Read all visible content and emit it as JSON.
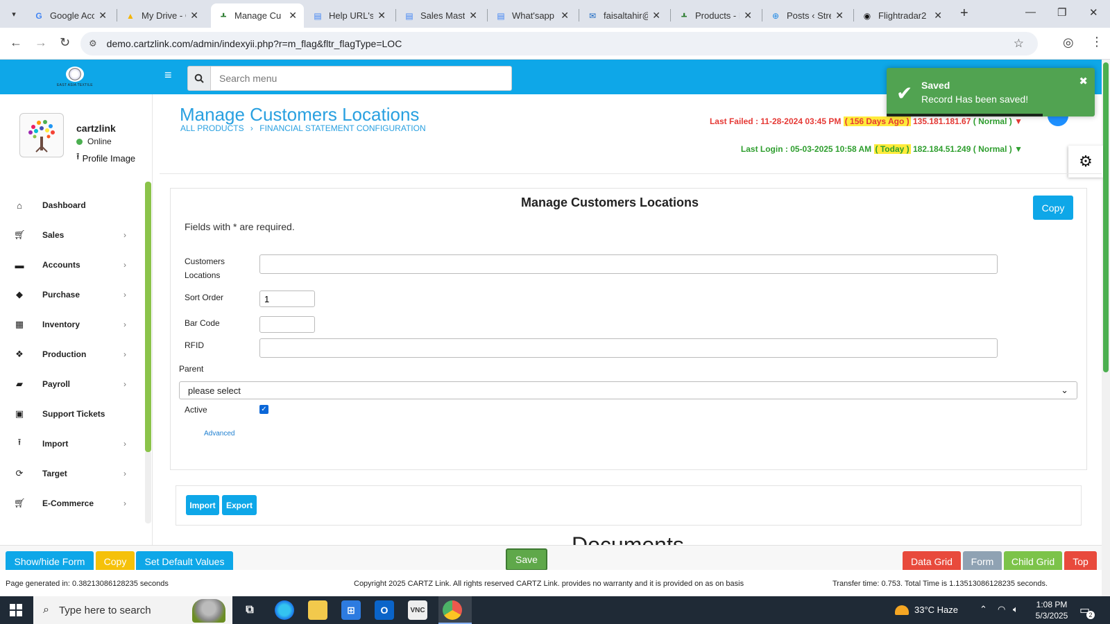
{
  "browser": {
    "tabs": [
      {
        "title": "Google Acc",
        "icon": "google-icon"
      },
      {
        "title": "My Drive - G",
        "icon": "drive-icon"
      },
      {
        "title": "Manage Cu",
        "icon": "cartz-icon",
        "active": true
      },
      {
        "title": "Help URL's",
        "icon": "docs-icon"
      },
      {
        "title": "Sales Maste",
        "icon": "docs-icon"
      },
      {
        "title": "What'sapp",
        "icon": "docs-icon"
      },
      {
        "title": "faisaltahir@",
        "icon": "mail-icon"
      },
      {
        "title": "Products - F",
        "icon": "cartz-icon"
      },
      {
        "title": "Posts ‹ Strea",
        "icon": "wordpress-icon"
      },
      {
        "title": "Flightradar2",
        "icon": "flightradar-icon"
      }
    ],
    "url": "demo.cartzlink.com/admin/indexyii.php?r=m_flag&fltr_flagType=LOC"
  },
  "header": {
    "brand_text": "EAST ASIA TEXTILE",
    "search_placeholder": "Search menu"
  },
  "profile": {
    "name": "cartzlink",
    "status": "Online",
    "image_link": "Profile Image"
  },
  "sidebar": {
    "items": [
      {
        "label": "Dashboard",
        "icon": "home-icon",
        "has_children": false
      },
      {
        "label": "Sales",
        "icon": "cart-icon",
        "has_children": true
      },
      {
        "label": "Accounts",
        "icon": "briefcase-icon",
        "has_children": true
      },
      {
        "label": "Purchase",
        "icon": "tags-icon",
        "has_children": true
      },
      {
        "label": "Inventory",
        "icon": "grid-icon",
        "has_children": true
      },
      {
        "label": "Production",
        "icon": "dropbox-icon",
        "has_children": true
      },
      {
        "label": "Payroll",
        "icon": "money-icon",
        "has_children": true
      },
      {
        "label": "Support Tickets",
        "icon": "gift-icon",
        "has_children": false
      },
      {
        "label": "Import",
        "icon": "upload-icon",
        "has_children": true
      },
      {
        "label": "Target",
        "icon": "refresh-icon",
        "has_children": true
      },
      {
        "label": "E-Commerce",
        "icon": "cart-icon",
        "has_children": true
      }
    ]
  },
  "page": {
    "title": "Manage Customers Locations",
    "breadcrumb": [
      "ALL PRODUCTS",
      "FINANCIAL STATEMENT CONFIGURATION"
    ],
    "last_failed": {
      "label": "Last Failed : 11-28-2024 03:45 PM",
      "ago": "( 156 Days Ago )",
      "ip": "135.181.181.67",
      "state": "( Normal )"
    },
    "last_login": {
      "label": "Last Login : 05-03-2025 10:58 AM",
      "ago": "( Today )",
      "ip": "182.184.51.249",
      "state": "( Normal )"
    }
  },
  "toast": {
    "title": "Saved",
    "message": "Record Has been saved!",
    "color": "#51a351"
  },
  "form": {
    "title": "Manage Customers Locations",
    "copy_label": "Copy",
    "required_note": "Fields with * are required.",
    "fields": {
      "customers_locations": {
        "label_line1": "Customers",
        "label_line2": "Locations",
        "value": ""
      },
      "sort_order": {
        "label": "Sort Order",
        "value": "1"
      },
      "bar_code": {
        "label": "Bar Code",
        "value": ""
      },
      "rfid": {
        "label": "RFID",
        "value": ""
      },
      "parent": {
        "label": "Parent",
        "selected": "please select"
      },
      "active": {
        "label": "Active",
        "checked": true
      }
    },
    "advanced_link": "Advanced"
  },
  "import_export": {
    "import_label": "Import",
    "export_label": "Export",
    "documents_heading": "Documents"
  },
  "action_bar": {
    "show_hide_form": "Show/hide Form",
    "copy": "Copy",
    "set_default_values": "Set Default Values",
    "save": "Save",
    "data_grid": "Data Grid",
    "form": "Form",
    "child_grid": "Child Grid",
    "top": "Top"
  },
  "footer": {
    "page_generated": "Page generated in: 0.38213086128235 seconds",
    "copyright": "Copyright 2025 CARTZ Link. All rights reserved CARTZ Link. provides no warranty and it is provided on as on basis",
    "transfer_time": "Transfer time: 0.753. Total Time is 1.13513086128235 seconds."
  },
  "taskbar": {
    "search_placeholder": "Type here to search",
    "weather": "33°C  Haze",
    "time": "1:08 PM",
    "date": "5/3/2025",
    "notification_count": "2"
  },
  "colors": {
    "accent": "#0ea7e8",
    "title_blue": "#29a0e0",
    "failed_red": "#e53935",
    "login_green": "#2e9e2e"
  }
}
